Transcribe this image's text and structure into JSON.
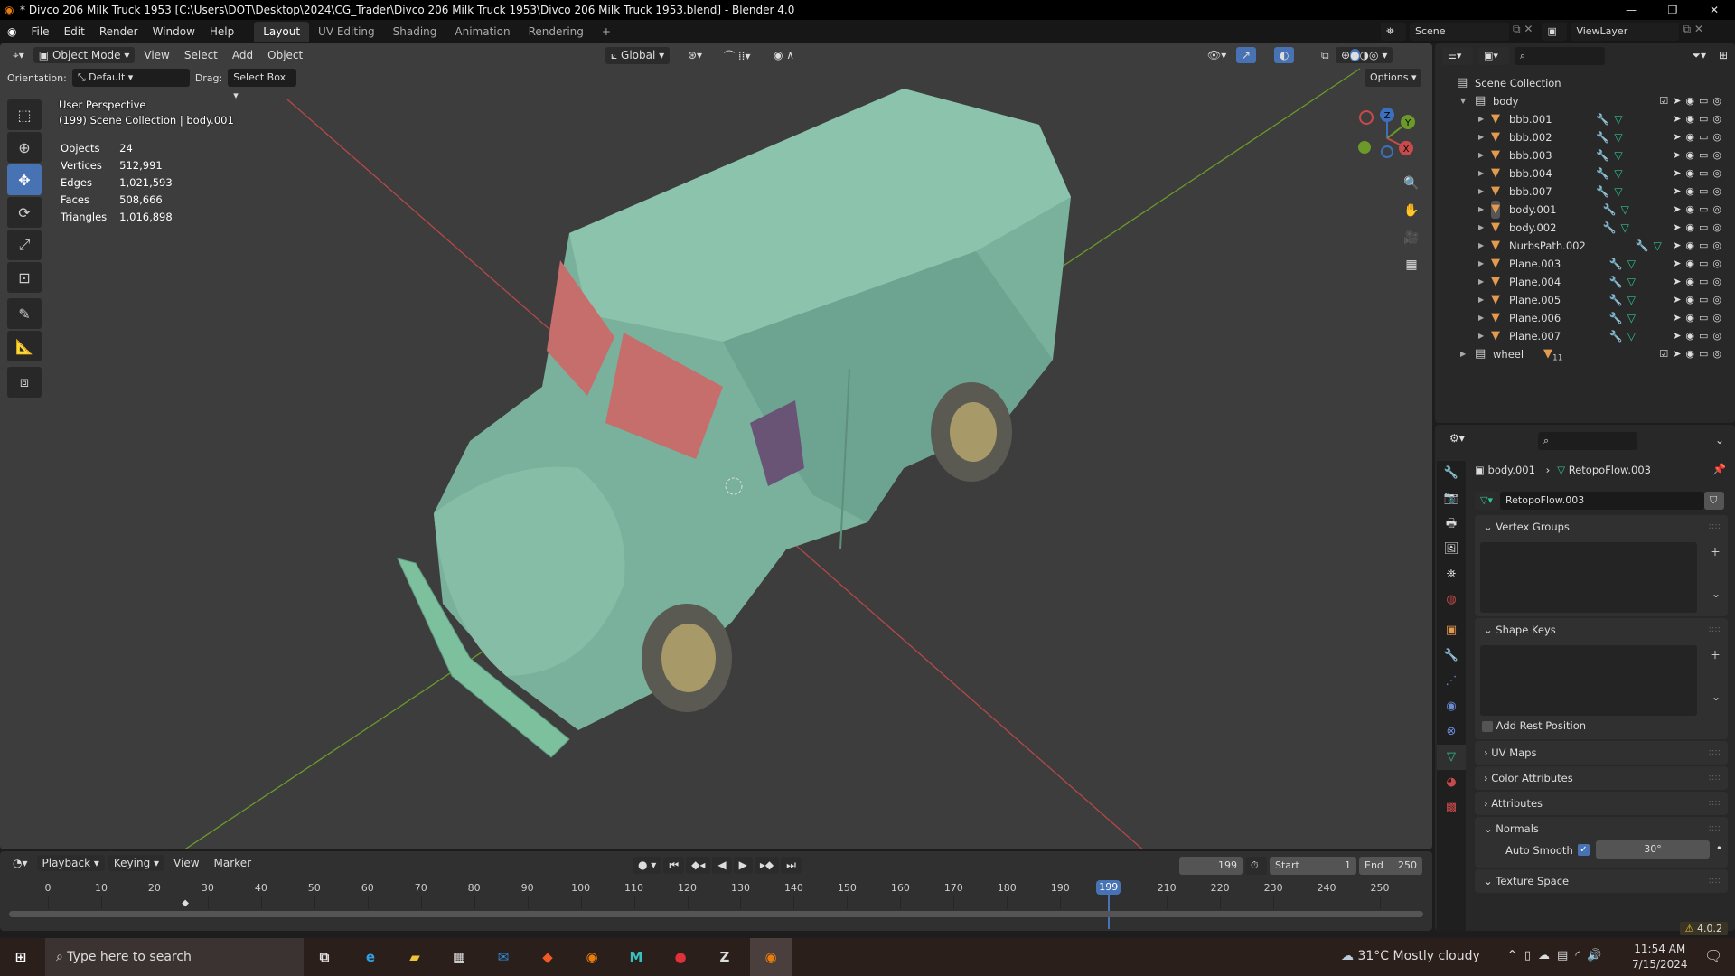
{
  "title": "* Divco 206 Milk Truck 1953 [C:\\Users\\DOT\\Desktop\\2024\\CG_Trader\\Divco 206 Milk Truck 1953\\Divco 206 Milk Truck 1953.blend] - Blender 4.0",
  "menu": [
    "File",
    "Edit",
    "Render",
    "Window",
    "Help"
  ],
  "workspaces": [
    "Layout",
    "UV Editing",
    "Shading",
    "Animation",
    "Rendering",
    "+"
  ],
  "scene": "Scene",
  "view_layer": "ViewLayer",
  "viewport": {
    "mode": "Object Mode",
    "menus": [
      "View",
      "Select",
      "Add",
      "Object"
    ],
    "transform": "Global",
    "orientation_label": "Orientation:",
    "orientation": "Default",
    "drag_label": "Drag:",
    "drag": "Select Box",
    "options": "Options",
    "view_name": "User Perspective",
    "context": "(199) Scene Collection | body.001",
    "stats": [
      {
        "label": "Objects",
        "value": "24"
      },
      {
        "label": "Vertices",
        "value": "512,991"
      },
      {
        "label": "Edges",
        "value": "1,021,593"
      },
      {
        "label": "Faces",
        "value": "508,666"
      },
      {
        "label": "Triangles",
        "value": "1,016,898"
      }
    ],
    "gizmo_axes": [
      "Z",
      "Y",
      "X"
    ]
  },
  "outliner": {
    "root": "Scene Collection",
    "collections": [
      {
        "name": "body",
        "expanded": true,
        "objects": [
          "bbb.001",
          "bbb.002",
          "bbb.003",
          "bbb.004",
          "bbb.007",
          "body.001",
          "body.002",
          "NurbsPath.002",
          "Plane.003",
          "Plane.004",
          "Plane.005",
          "Plane.006",
          "Plane.007"
        ]
      },
      {
        "name": "wheel",
        "expanded": false,
        "count": "11"
      }
    ],
    "selected": "body.001"
  },
  "properties": {
    "object": "body.001",
    "mesh": "RetopoFlow.003",
    "panels": {
      "vertex_groups": "Vertex Groups",
      "shape_keys": "Shape Keys",
      "add_rest_position": "Add Rest Position",
      "uv_maps": "UV Maps",
      "color_attributes": "Color Attributes",
      "attributes": "Attributes",
      "normals": "Normals",
      "auto_smooth": "Auto Smooth",
      "auto_smooth_angle": "30°",
      "texture_space": "Texture Space"
    }
  },
  "timeline": {
    "menus": [
      "Playback",
      "Keying",
      "View",
      "Marker"
    ],
    "current_frame": "199",
    "start_label": "Start",
    "start": "1",
    "end_label": "End",
    "end": "250",
    "ticks": [
      "0",
      "10",
      "20",
      "30",
      "40",
      "50",
      "60",
      "70",
      "80",
      "90",
      "100",
      "110",
      "120",
      "130",
      "140",
      "150",
      "160",
      "170",
      "180",
      "190",
      "210",
      "220",
      "230",
      "240",
      "250"
    ],
    "keyframe": 26
  },
  "version": "4.0.2",
  "taskbar": {
    "search_placeholder": "Type here to search",
    "weather": "31°C  Mostly cloudy",
    "time": "11:54 AM",
    "date": "7/15/2024"
  },
  "colors": {
    "accent": "#4772b3",
    "object": "#e49a4e",
    "mesh": "#2ec28e",
    "x_axis": "#c94a4a",
    "y_axis": "#6b9a2a",
    "truck": "#7fb8a2"
  }
}
